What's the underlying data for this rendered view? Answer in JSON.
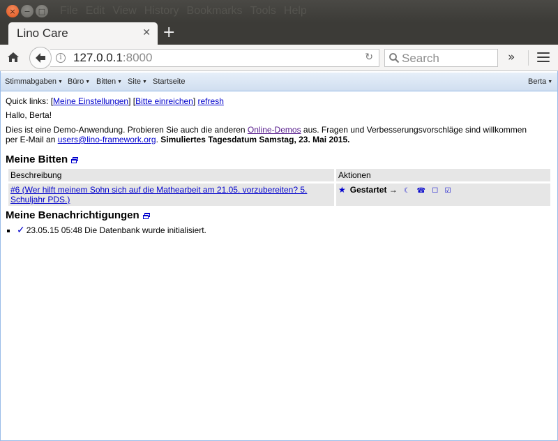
{
  "window": {
    "menu": [
      "File",
      "Edit",
      "View",
      "History",
      "Bookmarks",
      "Tools",
      "Help"
    ]
  },
  "tab": {
    "title": "Lino Care"
  },
  "urlbar": {
    "host": "127.0.0.1",
    "port": ":8000"
  },
  "searchbar": {
    "placeholder": "Search"
  },
  "toolbar": {
    "items": [
      {
        "label": "Stimmabgaben",
        "dropdown": true
      },
      {
        "label": "Büro",
        "dropdown": true
      },
      {
        "label": "Bitten",
        "dropdown": true
      },
      {
        "label": "Site",
        "dropdown": true
      },
      {
        "label": "Startseite",
        "dropdown": false
      }
    ],
    "user": "Berta"
  },
  "main": {
    "quicklinks_prefix": "Quick links:",
    "quicklinks": [
      "Meine Einstellungen",
      "Bitte einreichen",
      "refresh"
    ],
    "greeting": "Hallo, Berta!",
    "intro_1": "Dies ist eine Demo-Anwendung. Probieren Sie auch die anderen ",
    "intro_link": "Online-Demos",
    "intro_2": " aus. Fragen und Verbesserungsvorschläge sind willkommen",
    "intro_3": "per E-Mail an ",
    "email": "users@lino-framework.org",
    "intro_4": ". ",
    "sim_date": "Simuliertes Tagesdatum Samstag, 23. Mai 2015.",
    "bitten": {
      "title": "Meine Bitten",
      "columns": [
        "Beschreibung",
        "Aktionen"
      ],
      "rows": [
        {
          "description": "#6 (Wer hilft meinem Sohn sich auf die Mathearbeit am 21.05. vorzubereiten? 5. Schuljahr PDS.)",
          "star": "★",
          "state": "Gestartet",
          "arrow": "→",
          "actions": [
            "☾",
            "☎",
            "☐",
            "☑"
          ]
        }
      ]
    },
    "notifications": {
      "title": "Meine Benachrichtigungen",
      "items": [
        {
          "check": "✓",
          "text": "23.05.15 05:48 Die Datenbank wurde initialisiert."
        }
      ]
    }
  }
}
